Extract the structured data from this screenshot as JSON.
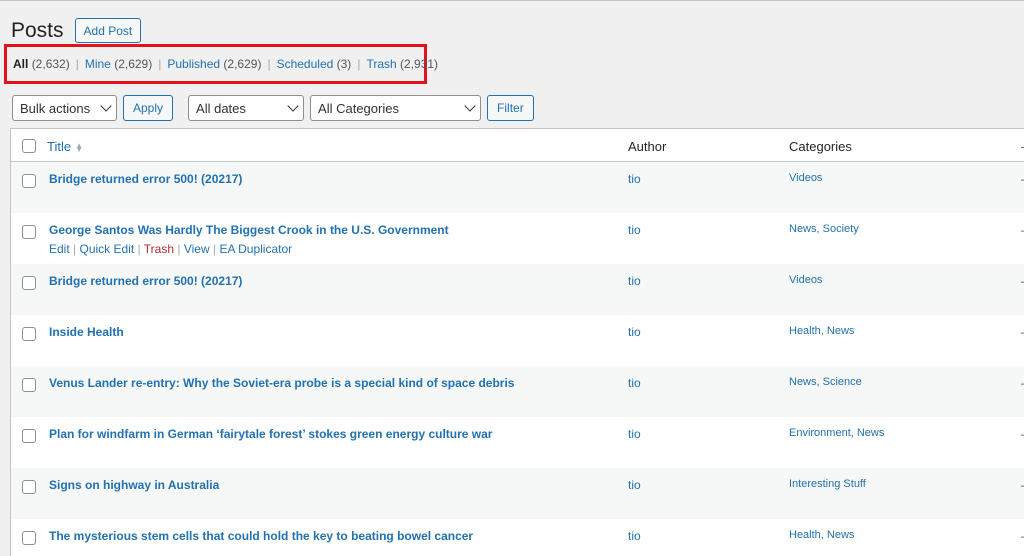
{
  "page_title": "Posts",
  "add_post_label": "Add Post",
  "views": [
    {
      "label": "All",
      "count": "(2,632)"
    },
    {
      "label": "Mine",
      "count": "(2,629)"
    },
    {
      "label": "Published",
      "count": "(2,629)"
    },
    {
      "label": "Scheduled",
      "count": "(3)"
    },
    {
      "label": "Trash",
      "count": "(2,931)"
    }
  ],
  "toolbar": {
    "bulk_actions": "Bulk actions",
    "apply": "Apply",
    "dates": "All dates",
    "categories": "All Categories",
    "filter": "Filter"
  },
  "columns": {
    "title": "Title",
    "author": "Author",
    "categories": "Categories",
    "date_dash": "–"
  },
  "row_actions": {
    "edit": "Edit",
    "quick_edit": "Quick Edit",
    "trash": "Trash",
    "view": "View",
    "duplicator": "EA Duplicator",
    "sep": "|"
  },
  "rows": [
    {
      "title": "Bridge returned error 500! (20217)",
      "author": "tio",
      "categories": "Videos"
    },
    {
      "title": "George Santos Was Hardly The Biggest Crook in the U.S. Government",
      "author": "tio",
      "categories": "News, Society"
    },
    {
      "title": "Bridge returned error 500! (20217)",
      "author": "tio",
      "categories": "Videos"
    },
    {
      "title": "Inside Health",
      "author": "tio",
      "categories": "Health, News"
    },
    {
      "title": "Venus Lander re-entry: Why the Soviet-era probe is a special kind of space debris",
      "author": "tio",
      "categories": "News, Science"
    },
    {
      "title": "Plan for windfarm in German ‘fairytale forest’ stokes green energy culture war",
      "author": "tio",
      "categories": "Environment, News"
    },
    {
      "title": "Signs on highway in Australia",
      "author": "tio",
      "categories": "Interesting Stuff"
    },
    {
      "title": "The mysterious stem cells that could hold the key to beating bowel cancer",
      "author": "tio",
      "categories": "Health, News"
    }
  ]
}
